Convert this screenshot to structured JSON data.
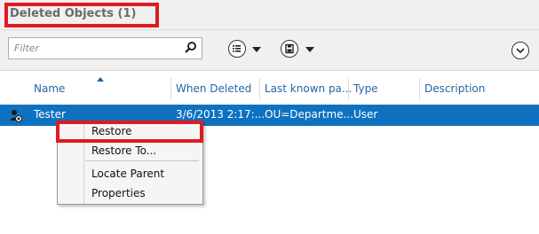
{
  "title": "Deleted Objects  (1)",
  "filter": {
    "placeholder": "Filter"
  },
  "columns": [
    "Name",
    "When Deleted",
    "Last known pa...",
    "Type",
    "Description"
  ],
  "row": {
    "name": "Tester",
    "when_deleted": "3/6/2013 2:17:...",
    "last_known_parent": "OU=Departme...",
    "type": "User",
    "description": ""
  },
  "context_menu": [
    "Restore",
    "Restore To...",
    "Locate Parent",
    "Properties"
  ],
  "colors": {
    "highlight": "#e01a22",
    "selection": "#0e72c1",
    "header_text": "#2467a3"
  }
}
